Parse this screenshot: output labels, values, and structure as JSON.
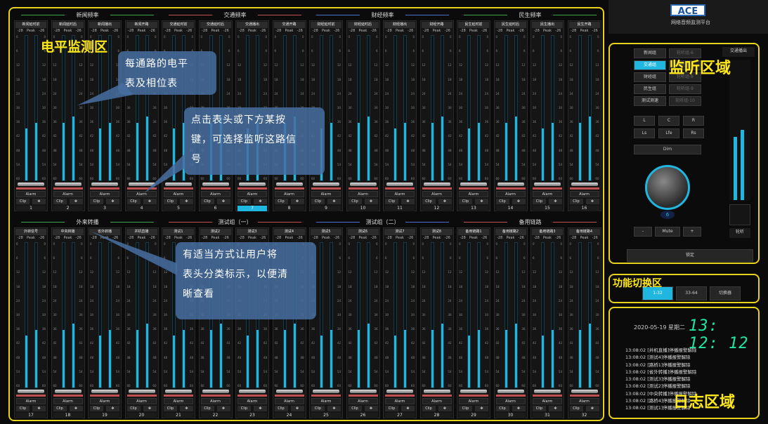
{
  "row1_groups": [
    {
      "label": "新闻频率",
      "line": "#3fa34d"
    },
    {
      "label": "交通频率",
      "line": "#c0504d"
    },
    {
      "label": "财经频率",
      "line": "#4a6fd0"
    },
    {
      "label": "民生频率",
      "line": "#3fa34d"
    }
  ],
  "row2_groups": [
    {
      "label": "外来转播",
      "line": "#3fa34d"
    },
    {
      "label": "测试组（一）",
      "line": "#c0504d"
    },
    {
      "label": "测试组（二）",
      "line": "#4a6fd0"
    },
    {
      "label": "备用链路",
      "line": "#c0504d"
    }
  ],
  "row1_channels": [
    {
      "name": "新闻延时前",
      "level": 0.36,
      "num": "1"
    },
    {
      "name": "新闻延时后",
      "level": 0.4,
      "num": "2"
    },
    {
      "name": "新闻播出",
      "level": 0.36,
      "num": "3"
    },
    {
      "name": "新闻开路",
      "level": 0.4,
      "num": "4"
    },
    {
      "name": "交通延时前",
      "level": 0.36,
      "num": "5"
    },
    {
      "name": "交通延时后",
      "level": 0.4,
      "num": "6"
    },
    {
      "name": "交通播出",
      "level": 0.36,
      "num": "7"
    },
    {
      "name": "交通开路",
      "level": 0.4,
      "num": "8"
    },
    {
      "name": "财经延时前",
      "level": 0.36,
      "num": "9"
    },
    {
      "name": "财经延时后",
      "level": 0.4,
      "num": "10"
    },
    {
      "name": "财经播出",
      "level": 0.36,
      "num": "11"
    },
    {
      "name": "财经开路",
      "level": 0.4,
      "num": "12"
    },
    {
      "name": "民生延时前",
      "level": 0.36,
      "num": "13"
    },
    {
      "name": "民生延时后",
      "level": 0.4,
      "num": "14"
    },
    {
      "name": "民生播出",
      "level": 0.36,
      "num": "15"
    },
    {
      "name": "民生开路",
      "level": 0.4,
      "num": "16"
    }
  ],
  "row2_channels": [
    {
      "name": "外转信号",
      "level": 0.36,
      "num": "17"
    },
    {
      "name": "中央转播",
      "level": 0.4,
      "num": "18"
    },
    {
      "name": "省外转播",
      "level": 0.36,
      "num": "19"
    },
    {
      "name": "并机直播",
      "level": 0.4,
      "num": "20"
    },
    {
      "name": "测试1",
      "level": 0.36,
      "num": "21"
    },
    {
      "name": "测试2",
      "level": 0.4,
      "num": "22"
    },
    {
      "name": "测试3",
      "level": 0.36,
      "num": "23"
    },
    {
      "name": "测试4",
      "level": 0.4,
      "num": "24"
    },
    {
      "name": "测试5",
      "level": 0.36,
      "num": "25"
    },
    {
      "name": "测试6",
      "level": 0.4,
      "num": "26"
    },
    {
      "name": "测试7",
      "level": 0.36,
      "num": "27"
    },
    {
      "name": "测试8",
      "level": 0.4,
      "num": "28"
    },
    {
      "name": "备用链路1",
      "level": 0.36,
      "num": "29"
    },
    {
      "name": "备用链路2",
      "level": 0.4,
      "num": "30"
    },
    {
      "name": "备用链路3",
      "level": 0.36,
      "num": "31"
    },
    {
      "name": "备用链路4",
      "level": 0.4,
      "num": "32"
    }
  ],
  "selected_channel": "7",
  "strip_text": {
    "peak": "Peak",
    "ref_left": "-28",
    "ref_right": "-26",
    "alarm": "Alarm",
    "clip": "Clip",
    "gear": "✥"
  },
  "scale_ticks": [
    "0",
    "6",
    "12",
    "18",
    "24",
    "30",
    "36",
    "42",
    "48",
    "54",
    "60"
  ],
  "annotations": {
    "level_zone": "电平监测区",
    "listen_zone": "监听区域",
    "func_zone": "功能切换区",
    "log_zone": "日志区域",
    "bubble1": [
      "每通路的电平",
      "表及相位表"
    ],
    "bubble2": [
      "点击表头或下方某按",
      "键，可选择监听这路信",
      "号"
    ],
    "bubble3": [
      "有适当方式让用户将",
      "表头分类标示，以便清",
      "晰查看"
    ]
  },
  "logo": {
    "badge": "ACE",
    "subtitle": "网络音频监测平台"
  },
  "listen": {
    "groups_left": [
      "新闻组",
      "交通组",
      "财经组",
      "民生组",
      "测试测速"
    ],
    "groups_right": [
      "轮听组-6",
      "轮听组-7",
      "轮听组-8",
      "轮听组-9",
      "轮听组-10"
    ],
    "active_group": "交通组",
    "channels_row1": [
      "L",
      "C",
      "R"
    ],
    "channels_row2": [
      "Ls",
      "Lfe",
      "Rs"
    ],
    "dim": "Dim",
    "minus": "-",
    "mute": "Mute",
    "plus": "+",
    "lock": "锁定",
    "knob_value": "6",
    "meter_title": "交通播出",
    "meter_level": 0.45,
    "meter_footer": "轮听"
  },
  "func": {
    "tabs": [
      "1-32",
      "33-64",
      "切换器"
    ],
    "active": "1-32"
  },
  "log": {
    "date": "2020-05-19 星期二",
    "time": "13: 12: 12",
    "lines": [
      "13:08:02 [并机直播]停播报警解除",
      "13:08:02 [测试4]停播报警解除",
      "13:08:02 [路桥1]停播报警解除",
      "13:08:02 [省外转播]停播报警解除",
      "13:08:02 [测试3]停播报警解除",
      "13:08:02 [测试2]停播报警解除",
      "13:08:02 [中央转播]停播报警解除",
      "13:08:02 [路桥4]停播报警解除",
      "13:08:02 [测试1]停播报警解除"
    ]
  }
}
